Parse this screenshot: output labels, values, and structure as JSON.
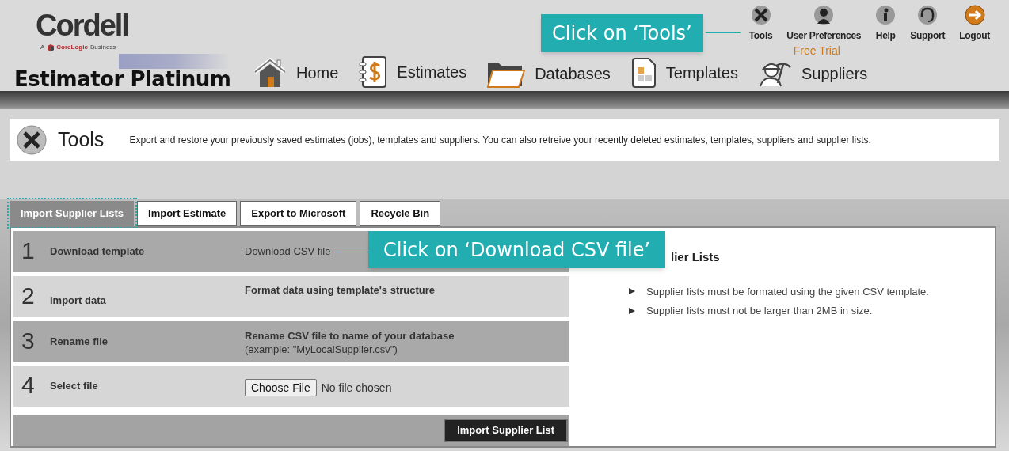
{
  "header": {
    "logo": {
      "brand": "Cordell",
      "tagline_prefix": "A",
      "tagline_company": "CoreLogic",
      "tagline_suffix": "Business"
    },
    "product": "Estimator Platinum",
    "nav": [
      {
        "label": "Home",
        "kind": "home"
      },
      {
        "label": "Estimates",
        "kind": "estimates"
      },
      {
        "label": "Databases",
        "kind": "databases"
      },
      {
        "label": "Templates",
        "kind": "templates"
      },
      {
        "label": "Suppliers",
        "kind": "suppliers"
      }
    ],
    "top_links": [
      {
        "label": "Tools",
        "kind": "tools"
      },
      {
        "label": "User Preferences",
        "kind": "user"
      },
      {
        "label": "Help",
        "kind": "help"
      },
      {
        "label": "Support",
        "kind": "support"
      },
      {
        "label": "Logout",
        "kind": "logout"
      }
    ],
    "account_status": "Free Trial"
  },
  "page_header": {
    "title": "Tools",
    "description": "Export and restore your previously saved estimates (jobs), templates and suppliers. You can also retreive your recently deleted estimates, templates, suppliers and supplier lists."
  },
  "tabs": [
    {
      "label": "Import Supplier Lists",
      "selected": true
    },
    {
      "label": "Import Estimate",
      "selected": false
    },
    {
      "label": "Export to Microsoft",
      "selected": false
    },
    {
      "label": "Recycle Bin",
      "selected": false
    }
  ],
  "steps": [
    {
      "number": "1",
      "label": "Download template",
      "kind": "link",
      "link": "Download CSV file"
    },
    {
      "number": "2",
      "label": "Import data",
      "kind": "text",
      "text": "Format data using template's structure"
    },
    {
      "number": "3",
      "label": "Rename file",
      "kind": "rename",
      "text": "Rename CSV file to name of your database",
      "note_prefix": "(example: \"",
      "note_link": "MyLocalSupplier.csv",
      "note_suffix": "\")"
    },
    {
      "number": "4",
      "label": "Select file",
      "kind": "file",
      "button": "Choose File",
      "status": "No file chosen"
    }
  ],
  "submit_button": "Import Supplier List",
  "info_panel": {
    "heading": "lier Lists",
    "bullets": [
      "Supplier lists must be formated using the given CSV template.",
      "Supplier lists must not be larger than 2MB in size."
    ]
  },
  "callouts": [
    {
      "text": "Click on ‘Tools’"
    },
    {
      "text": "Click on ‘Download CSV file’"
    }
  ]
}
